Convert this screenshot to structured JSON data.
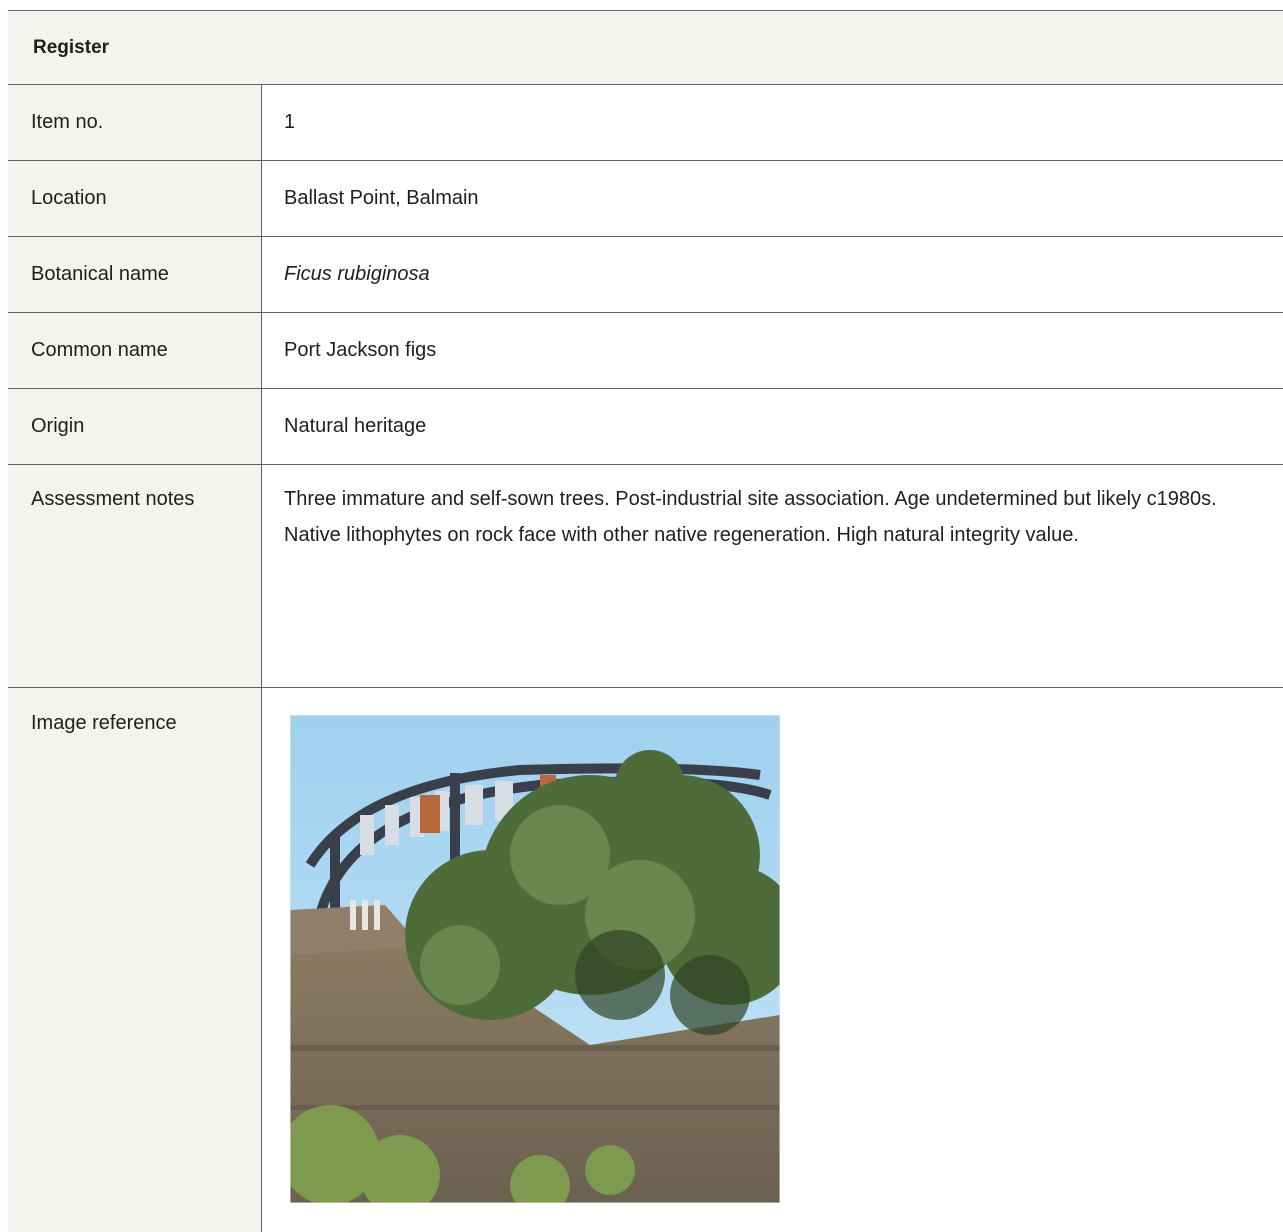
{
  "header": {
    "title": "Register"
  },
  "rows": {
    "item_no": {
      "label": "Item no.",
      "value": "1"
    },
    "location": {
      "label": "Location",
      "value": "Ballast Point, Balmain"
    },
    "botanical_name": {
      "label": "Botanical name",
      "value": "Ficus rubiginosa"
    },
    "common_name": {
      "label": "Common name",
      "value": "Port Jackson figs"
    },
    "origin": {
      "label": "Origin",
      "value": "Natural heritage"
    },
    "assessment_notes": {
      "label": "Assessment notes",
      "paragraphs": [
        "Three immature and self-sown trees. Post-industrial site association. Age undetermined but likely c1980s.",
        "Native lithophytes on rock face with other native regeneration. High natural integrity value."
      ]
    },
    "image_reference": {
      "label": "Image reference"
    }
  },
  "colors": {
    "label_background": "#f4f3ef",
    "rule": "#5a6470"
  }
}
